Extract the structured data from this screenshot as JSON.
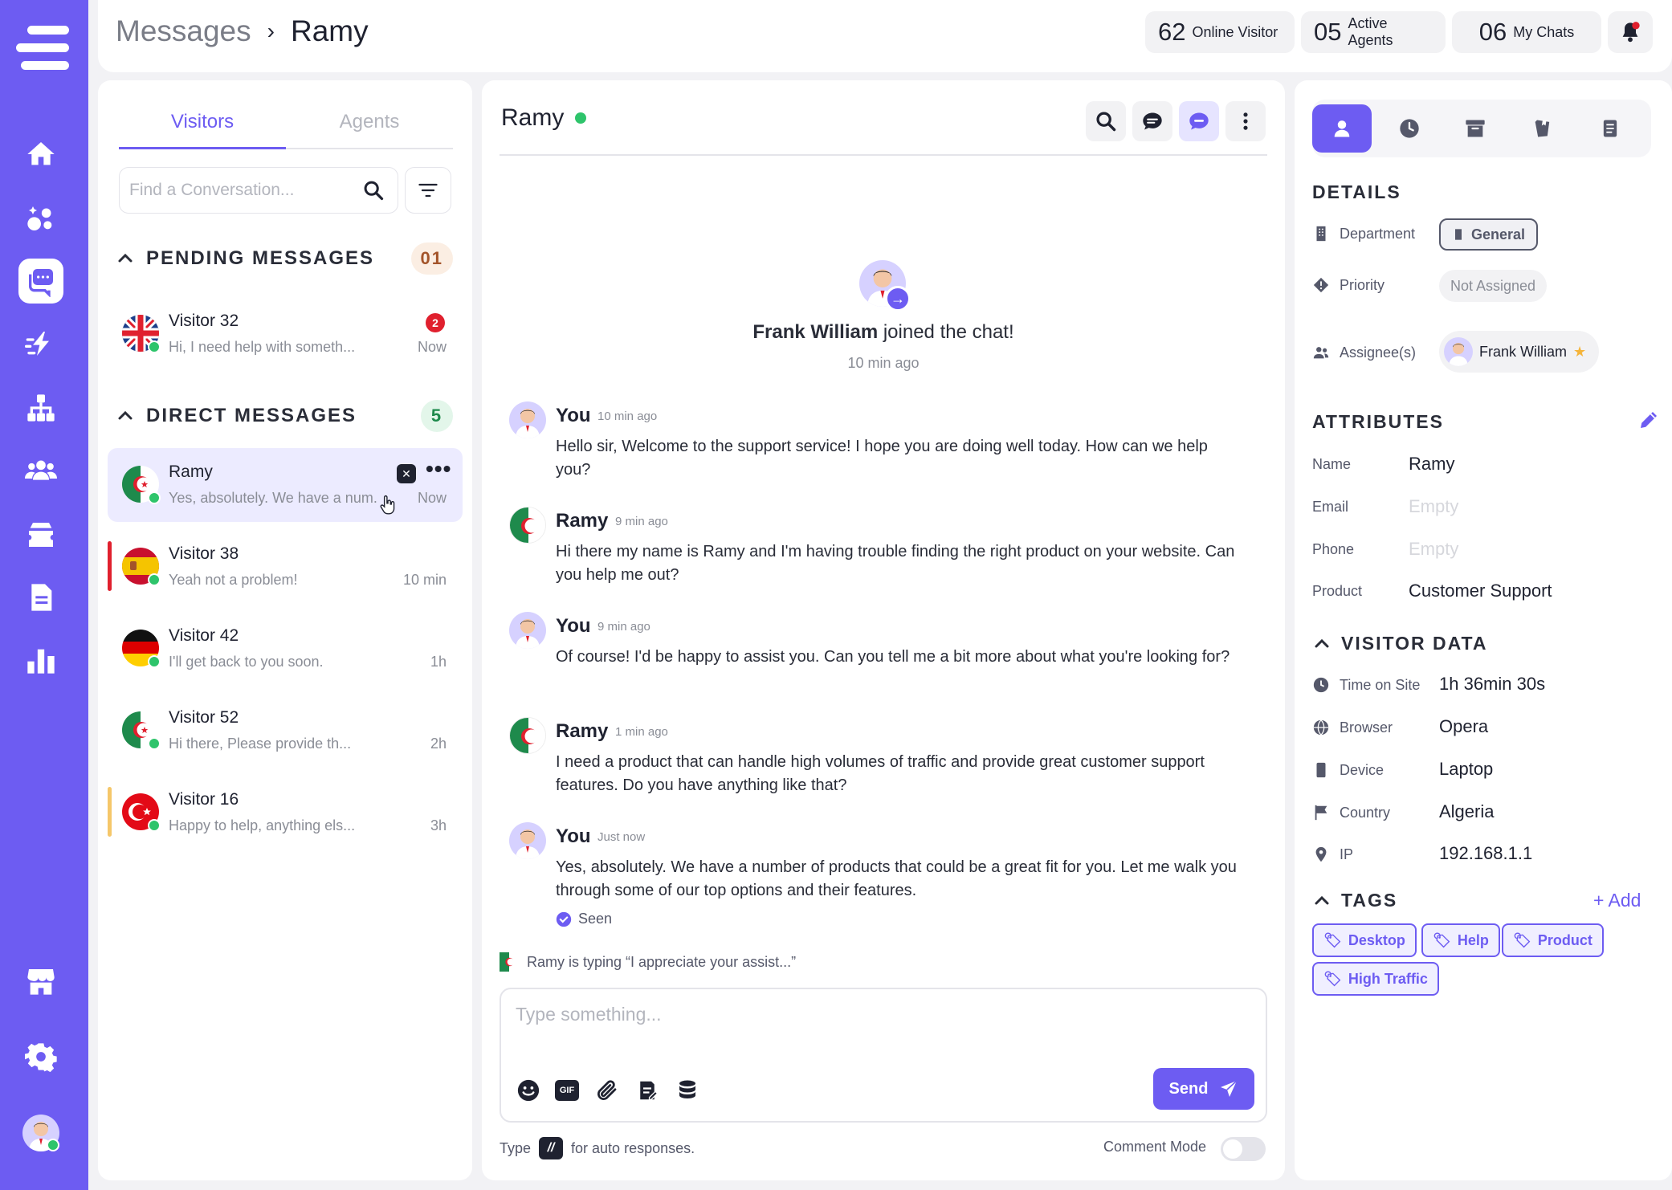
{
  "sidebar": {
    "items": [
      {
        "name": "home-icon"
      },
      {
        "name": "integrations-icon"
      },
      {
        "name": "messages-icon"
      },
      {
        "name": "speed-icon"
      },
      {
        "name": "org-chart-icon"
      },
      {
        "name": "team-icon"
      },
      {
        "name": "ticket-icon"
      },
      {
        "name": "document-icon"
      },
      {
        "name": "analytics-icon"
      },
      {
        "name": "store-icon"
      },
      {
        "name": "gear-icon"
      }
    ]
  },
  "header": {
    "breadcrumb_root": "Messages",
    "breadcrumb_current": "Ramy",
    "stats": [
      {
        "num": "62",
        "label": "Online Visitor"
      },
      {
        "num": "05",
        "label": "Active Agents"
      },
      {
        "num": "06",
        "label": "My Chats"
      }
    ]
  },
  "inbox": {
    "tabs": [
      "Visitors",
      "Agents"
    ],
    "search_placeholder": "Find a Conversation...",
    "pending": {
      "title": "PENDING MESSAGES",
      "count": "01",
      "items": [
        {
          "name": "Visitor 32",
          "preview": "Hi, I need help with someth...",
          "time": "Now",
          "unread": "2",
          "flag": "uk"
        }
      ]
    },
    "direct": {
      "title": "DIRECT MESSAGES",
      "count": "5",
      "items": [
        {
          "name": "Ramy",
          "preview": "Yes, absolutely. We have a num...",
          "time": "Now",
          "flag": "algeria"
        },
        {
          "name": "Visitor 38",
          "preview": "Yeah not a problem!",
          "time": "10 min",
          "flag": "spain"
        },
        {
          "name": "Visitor 42",
          "preview": "I'll get back to you soon.",
          "time": "1h",
          "flag": "germany"
        },
        {
          "name": "Visitor 52",
          "preview": "Hi there, Please provide th...",
          "time": "2h",
          "flag": "algeria"
        },
        {
          "name": "Visitor 16",
          "preview": "Happy to help, anything els...",
          "time": "3h",
          "flag": "turkey"
        }
      ]
    }
  },
  "chat": {
    "title": "Ramy",
    "join_name": "Frank William",
    "join_text": "joined the chat!",
    "join_time": "10 min ago",
    "messages": [
      {
        "author": "You",
        "time": "10 min ago",
        "text": "Hello sir, Welcome to the support service! I hope you are doing well today. How can we help you?"
      },
      {
        "author": "Ramy",
        "time": "9 min ago",
        "text": "Hi there my name is Ramy and I'm having trouble finding the right product on your website. Can you help me out?"
      },
      {
        "author": "You",
        "time": "9 min ago",
        "text": "Of course! I'd be happy to assist you. Can you tell me a bit more about what you're looking for?"
      },
      {
        "author": "Ramy",
        "time": "1 min ago",
        "text": "I need a product that can handle high volumes of traffic and provide great customer support features. Do you have anything like that?"
      },
      {
        "author": "You",
        "time": "Just now",
        "text": "Yes, absolutely. We have a number of products that could be a great fit for you. Let me walk you through some of our top options and their features."
      }
    ],
    "seen": "Seen",
    "typing": "Ramy is typing “I appreciate your assist...”",
    "composer_placeholder": "Type something...",
    "send_label": "Send",
    "hint_prefix": "Type",
    "hint_key": "//",
    "hint_suffix": "for auto responses.",
    "comment_mode": "Comment Mode"
  },
  "details": {
    "section_details": "DETAILS",
    "department_label": "Department",
    "department_value": "General",
    "priority_label": "Priority",
    "priority_value": "Not Assigned",
    "assignee_label": "Assignee(s)",
    "assignee_value": "Frank William",
    "section_attributes": "ATTRIBUTES",
    "attributes": [
      {
        "label": "Name",
        "value": "Ramy",
        "empty": false
      },
      {
        "label": "Email",
        "value": "Empty",
        "empty": true
      },
      {
        "label": "Phone",
        "value": "Empty",
        "empty": true
      },
      {
        "label": "Product",
        "value": "Customer Support",
        "empty": false
      }
    ],
    "section_visitor": "VISITOR DATA",
    "visitor": [
      {
        "label": "Time on Site",
        "value": "1h 36min 30s",
        "icon": "clock-icon"
      },
      {
        "label": "Browser",
        "value": "Opera",
        "icon": "globe-icon"
      },
      {
        "label": "Device",
        "value": "Laptop",
        "icon": "device-icon"
      },
      {
        "label": "Country",
        "value": "Algeria",
        "icon": "flag-icon"
      },
      {
        "label": "IP",
        "value": "192.168.1.1",
        "icon": "location-pin-icon"
      }
    ],
    "section_tags": "TAGS",
    "add_label": "+ Add",
    "tags": [
      "Desktop",
      "Help",
      "Product",
      "High Traffic"
    ]
  },
  "colors": {
    "accent": "#6d5cf2",
    "online": "#2ec46b",
    "unread": "#e0202e"
  }
}
